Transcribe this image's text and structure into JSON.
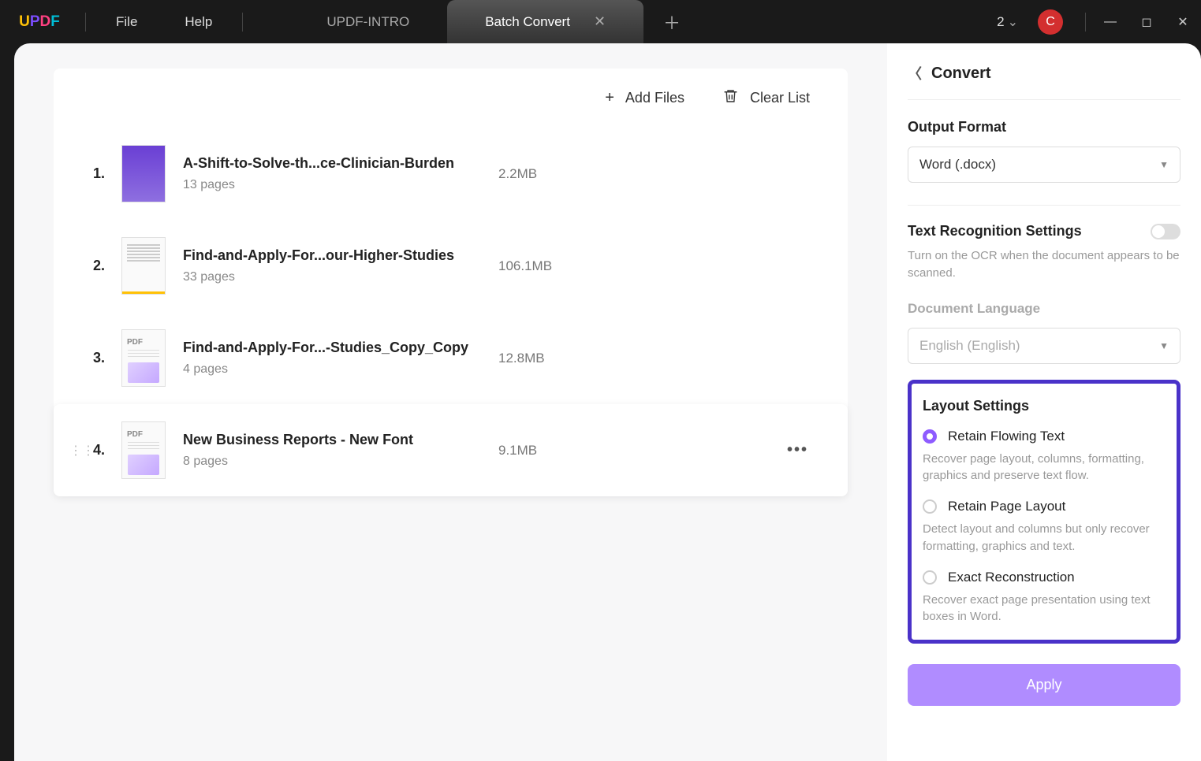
{
  "topbar": {
    "logo": [
      "U",
      "P",
      "D",
      "F"
    ],
    "menu": {
      "file": "File",
      "help": "Help"
    },
    "tabs": [
      {
        "label": "UPDF-INTRO",
        "active": false
      },
      {
        "label": "Batch Convert",
        "active": true
      }
    ],
    "windowCount": "2",
    "avatar": "C"
  },
  "listHeader": {
    "addFiles": "Add Files",
    "clearList": "Clear List"
  },
  "files": [
    {
      "num": "1.",
      "title": "A-Shift-to-Solve-th...ce-Clinician-Burden",
      "pages": "13 pages",
      "size": "2.2MB",
      "thumb": "purple"
    },
    {
      "num": "2.",
      "title": "Find-and-Apply-For...our-Higher-Studies",
      "pages": "33 pages",
      "size": "106.1MB",
      "thumb": "doc"
    },
    {
      "num": "3.",
      "title": "Find-and-Apply-For...-Studies_Copy_Copy",
      "pages": "4 pages",
      "size": "12.8MB",
      "thumb": "pdf"
    },
    {
      "num": "4.",
      "title": "New Business Reports - New Font",
      "pages": "8 pages",
      "size": "9.1MB",
      "thumb": "pdf",
      "hovered": true
    }
  ],
  "side": {
    "title": "Convert",
    "outputFormat": {
      "label": "Output Format",
      "value": "Word (.docx)"
    },
    "ocr": {
      "label": "Text Recognition Settings",
      "desc": "Turn on the OCR when the document appears to be scanned."
    },
    "docLang": {
      "label": "Document Language",
      "value": "English (English)"
    },
    "layout": {
      "title": "Layout Settings",
      "options": [
        {
          "label": "Retain Flowing Text",
          "desc": "Recover page layout, columns, formatting, graphics and preserve text flow.",
          "checked": true
        },
        {
          "label": "Retain Page Layout",
          "desc": "Detect layout and columns but only recover formatting, graphics and text.",
          "checked": false
        },
        {
          "label": "Exact Reconstruction",
          "desc": "Recover exact page presentation using text boxes in Word.",
          "checked": false
        }
      ]
    },
    "apply": "Apply"
  }
}
